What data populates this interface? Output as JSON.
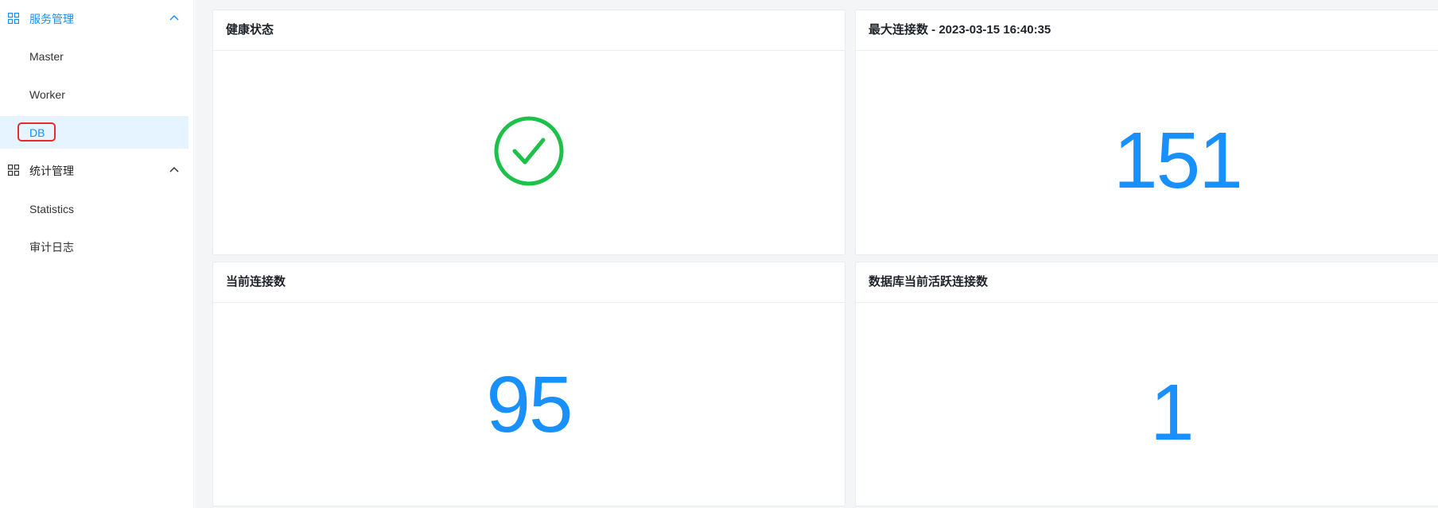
{
  "sidebar": {
    "groups": [
      {
        "label": "服务管理",
        "items": [
          {
            "label": "Master"
          },
          {
            "label": "Worker"
          },
          {
            "label": "DB"
          }
        ]
      },
      {
        "label": "统计管理",
        "items": [
          {
            "label": "Statistics"
          },
          {
            "label": "审计日志"
          }
        ]
      }
    ],
    "selected_item": "DB"
  },
  "cards": {
    "health": {
      "title": "健康状态",
      "status": "healthy"
    },
    "max_connections": {
      "title": "最大连接数 - 2023-03-15 16:40:35",
      "value": "151"
    },
    "current_connections": {
      "title": "当前连接数",
      "value": "95"
    },
    "active_connections": {
      "title": "数据库当前活跃连接数",
      "value": "1"
    }
  },
  "colors": {
    "accent": "#1890ff",
    "success": "#1cc14a",
    "highlight_box": "#ea2a2a",
    "selected_bg": "#e6f4ff"
  }
}
